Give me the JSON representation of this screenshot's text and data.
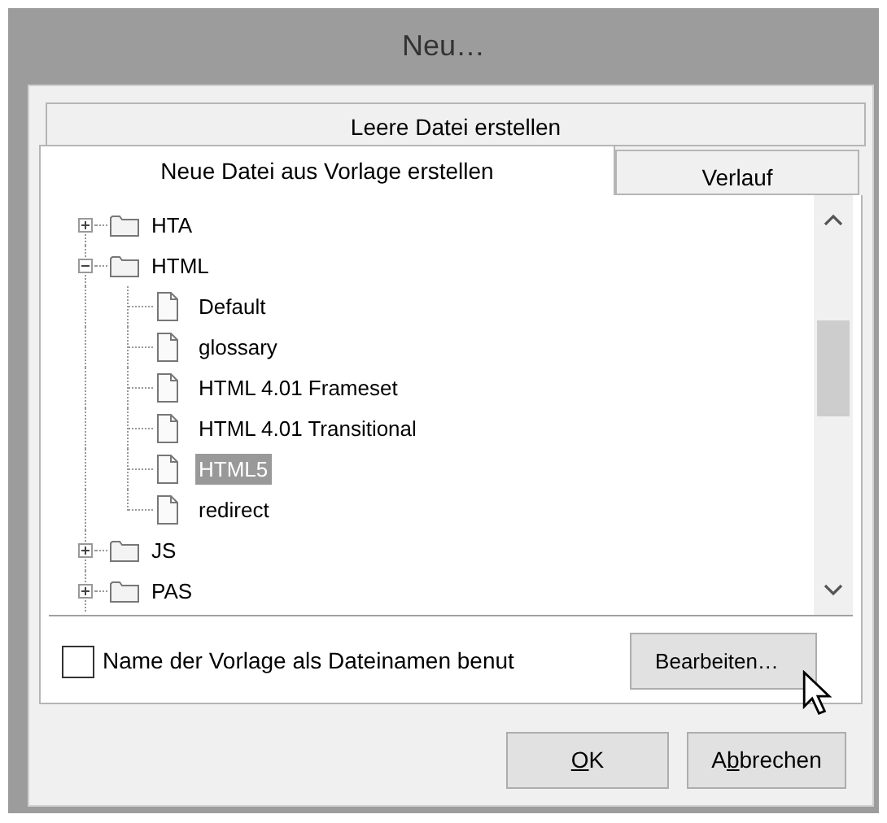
{
  "window": {
    "title": "Neu…"
  },
  "tabs_back": [
    {
      "label": "Leere Datei erstellen",
      "selected": false
    }
  ],
  "tabs": [
    {
      "label": "Neue Datei aus Vorlage erstellen",
      "selected": true
    },
    {
      "label": "Verlauf",
      "selected": false
    }
  ],
  "tree": [
    {
      "kind": "folder",
      "label": "HTA",
      "expanded": false,
      "selected": false
    },
    {
      "kind": "folder",
      "label": "HTML",
      "expanded": true,
      "selected": false,
      "children": [
        {
          "kind": "file",
          "label": "Default",
          "selected": false
        },
        {
          "kind": "file",
          "label": "glossary",
          "selected": false
        },
        {
          "kind": "file",
          "label": "HTML 4.01 Frameset",
          "selected": false
        },
        {
          "kind": "file",
          "label": "HTML 4.01 Transitional",
          "selected": false
        },
        {
          "kind": "file",
          "label": "HTML5",
          "selected": true
        },
        {
          "kind": "file",
          "label": "redirect",
          "selected": false
        }
      ]
    },
    {
      "kind": "folder",
      "label": "JS",
      "expanded": false,
      "selected": false
    },
    {
      "kind": "folder",
      "label": "PAS",
      "expanded": false,
      "selected": false
    }
  ],
  "checkbox": {
    "label": "Name der Vorlage als Dateinamen benut",
    "checked": false
  },
  "edit_button": {
    "label": "Bearbeiten…"
  },
  "buttons": [
    {
      "key": "O",
      "after": "K"
    },
    {
      "before": "A",
      "key": "b",
      "after": "brechen"
    }
  ]
}
